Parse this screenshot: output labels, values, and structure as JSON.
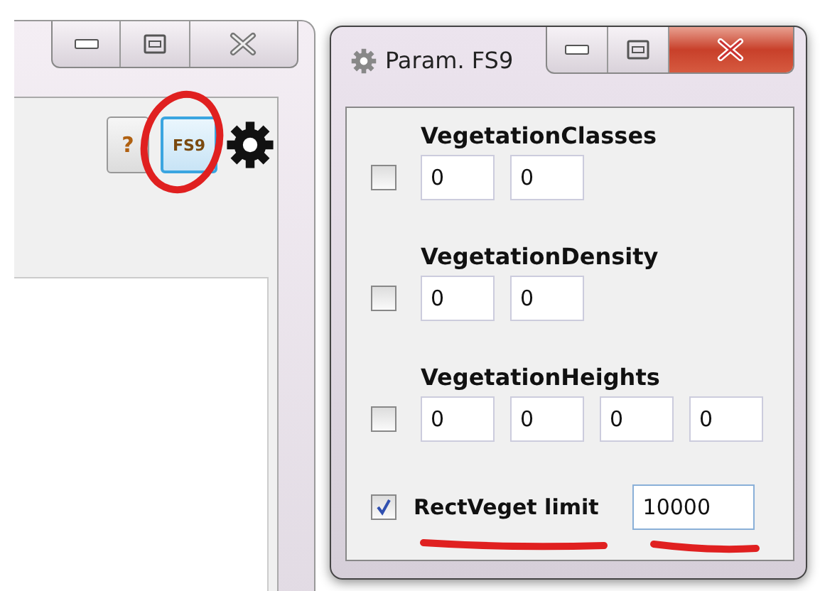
{
  "main_window": {
    "toolbar": [
      {
        "kind": "text",
        "label": "?",
        "selected": false
      },
      {
        "kind": "text",
        "label": "FS9",
        "selected": true
      },
      {
        "kind": "gear"
      }
    ]
  },
  "dialog": {
    "title": "Param. FS9",
    "groups": [
      {
        "label": "VegetationClasses",
        "checked": false,
        "values": [
          "0",
          "0"
        ]
      },
      {
        "label": "VegetationDensity",
        "checked": false,
        "values": [
          "0",
          "0"
        ]
      },
      {
        "label": "VegetationHeights",
        "checked": false,
        "values": [
          "0",
          "0",
          "0",
          "0"
        ]
      }
    ],
    "limit": {
      "label": "RectVeget limit",
      "checked": true,
      "value": "10000"
    }
  }
}
